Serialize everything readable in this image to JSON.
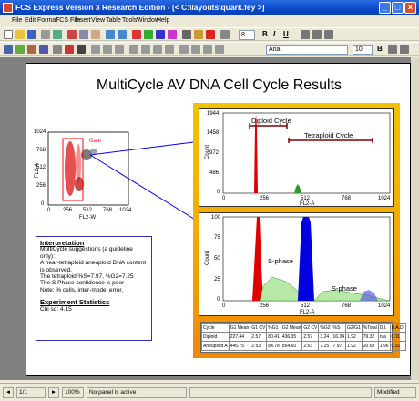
{
  "window": {
    "title": "FCS Express Version 3 Research Edition - [< C:\\layouts\\quark.fey >]"
  },
  "menu": [
    "File",
    "Edit",
    "Format",
    "FCS File",
    "Insert",
    "View",
    "Table",
    "Tools",
    "Window",
    "Help"
  ],
  "format_toolbar": {
    "font_name": "Arial",
    "font_size": "10",
    "bold": "B",
    "italic": "I",
    "underline": "U"
  },
  "toolbar1": {
    "font_size_field": "8"
  },
  "page": {
    "title": "MultiCycle AV DNA Cell Cycle Results"
  },
  "dotplot": {
    "y_label": "FL2-A",
    "x_label": "FL2-W",
    "gate_label": "Gate",
    "y_ticks": [
      "1024",
      "768",
      "512",
      "256",
      "0"
    ],
    "x_ticks": [
      "0",
      "256",
      "512",
      "768",
      "1024"
    ]
  },
  "histogram_top": {
    "y_label": "Count",
    "x_label": "FL2-A",
    "y_ticks": [
      "1944",
      "1458",
      "972",
      "486",
      "0"
    ],
    "x_ticks": [
      "0",
      "256",
      "512",
      "768",
      "1024"
    ],
    "diploid_label": "Diploid Cycle",
    "tetraploid_label": "Tetraploid Cycle"
  },
  "histogram_bottom": {
    "y_label": "Count",
    "y_ticks": [
      "100",
      "75",
      "50",
      "25",
      "0"
    ],
    "x_ticks": [
      "0",
      "256",
      "512",
      "768",
      "1024"
    ],
    "x_label": "FL2-A",
    "sphase_label_1": "S-phase",
    "sphase_label_2": "S-phase"
  },
  "results_table": {
    "headers": [
      "Cycle",
      "G1 Mean",
      "G1 CV",
      "%G1",
      "G2 Mean",
      "G2 CV",
      "%G2",
      "%S",
      "G2/G1",
      "%Total",
      "D.I.",
      "B.A.D."
    ],
    "rows": [
      [
        "Diploid",
        "227.44",
        "2.57",
        "80.41",
        "436.05",
        "2.57",
        "3.24",
        "16.34",
        "1.92",
        "79.32",
        "n/a",
        "0.11"
      ],
      [
        "Aneuploid A",
        "445.75",
        "2.53",
        "84.78",
        "854.60",
        "2.53",
        "7.25",
        "7.97",
        "1.92",
        "20.69",
        "1.96",
        "0.31"
      ]
    ]
  },
  "interpretation": {
    "heading": "Interpretation",
    "lines": [
      "MultiCycle suggestions (a guideline only):",
      "A near-tetraploid aneuploid DNA content is observed.",
      "The tetraploid %S=7.97, %G2=7.25",
      "The S Phase confidence is poor",
      "Note: % cells, inter-model error,"
    ],
    "stats_heading": "Experiment Statistics",
    "chi_sq": "Chi sq: 4.15"
  },
  "status": {
    "page": "1/1",
    "zoom": "100%",
    "panel": "No panel is active",
    "modified": "Modified"
  },
  "colors": {
    "titlebar": "#0a48c8",
    "gradient_top": "#f2c200",
    "gradient_bottom": "#f08800",
    "g1_peak": "#e00000",
    "g2_peak": "#0000e0",
    "sphase": "#2a9a2a"
  }
}
